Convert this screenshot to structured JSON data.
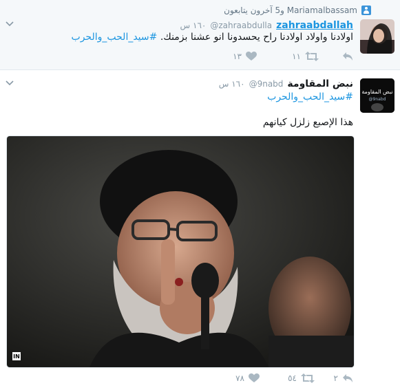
{
  "tweet1": {
    "context_text": "Mariamalbassam و5 آخرون يتابعون",
    "author_name": "zahraabdallah",
    "handle": "@zahraabdulla",
    "time": "١٦٠ س",
    "text_main": "اولادنا واولاد اولادنا راح يحسدونا انو عشنا بزمنك.",
    "hashtag": "#سيد_الحب_والحرب",
    "retweets": "١١",
    "likes": "١٣"
  },
  "tweet2": {
    "author_name": "نبض المقاومة",
    "handle": "@9nabd",
    "time": "١٦٠ س",
    "hashtag": "#سيد_الحب_والحرب",
    "text_main": "هذا الإصبع زلزل كيانهم",
    "replies": "٢",
    "retweets": "٥٤",
    "likes": "٧٨",
    "avatar_text": "نبض المقاومة",
    "avatar_handle": "@9nabd",
    "photo_watermark": "IN"
  },
  "colors": {
    "link": "#1b95e0",
    "muted": "#8899a6",
    "bg_highlight": "#f5f8fa"
  }
}
